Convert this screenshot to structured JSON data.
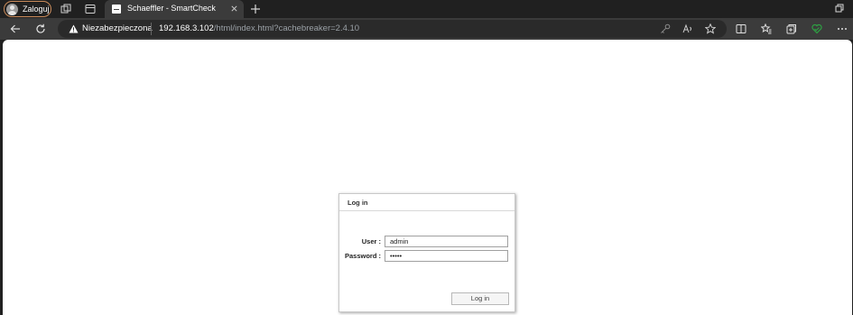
{
  "browser": {
    "profile_label": "Zaloguj",
    "tab_title": "Schaeffler - SmartCheck",
    "security_label": "Niezabezpieczona",
    "url_host": "192.168.3.102",
    "url_path": "/html/index.html?cachebreaker=2.4.10",
    "theme": {
      "titlebar": "#202020",
      "toolbar": "#3b3b3b",
      "accent_green": "#2ea043"
    }
  },
  "login": {
    "title": "Log in",
    "user_label": "User :",
    "user_value": "admin",
    "password_label": "Password :",
    "password_value": "•••••",
    "submit_label": "Log in"
  }
}
